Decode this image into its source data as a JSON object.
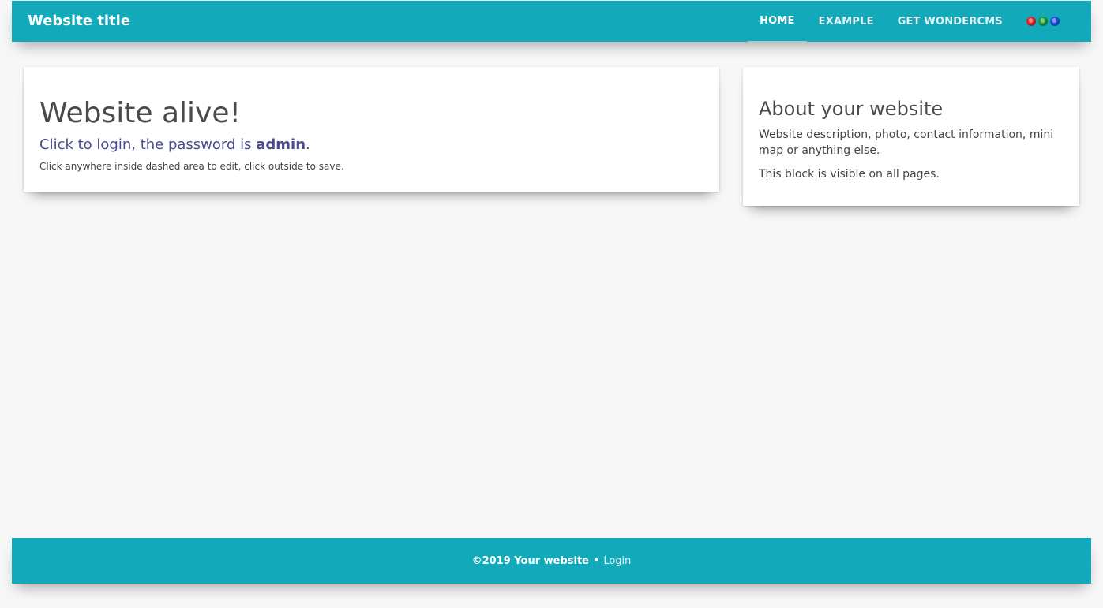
{
  "header": {
    "brand": "Website title",
    "nav": [
      {
        "label": "HOME",
        "active": true
      },
      {
        "label": "EXAMPLE",
        "active": false
      },
      {
        "label": "GET WONDERCMS",
        "active": false
      }
    ],
    "globe_icons": [
      {
        "name": "globe-red-icon",
        "color": "#e0242b"
      },
      {
        "name": "globe-green-icon",
        "color": "#1e9b3a"
      },
      {
        "name": "globe-blue-icon",
        "color": "#1f4fe0"
      }
    ]
  },
  "main": {
    "title": "Website alive!",
    "subtitle_prefix": "Click to login, the password is ",
    "subtitle_bold": "admin",
    "subtitle_suffix": ".",
    "note": "Click anywhere inside dashed area to edit, click outside to save."
  },
  "sidebar": {
    "title": "About your website",
    "paragraph1": "Website description, photo, contact information, mini map or anything else.",
    "paragraph2": "This block is visible on all pages."
  },
  "footer": {
    "copyright": "©2019 Your website",
    "separator": "•",
    "login": "Login"
  },
  "colors": {
    "accent": "#12a9bb",
    "link_purple": "#4a4a8f",
    "page_bg": "#f7f7f7"
  }
}
